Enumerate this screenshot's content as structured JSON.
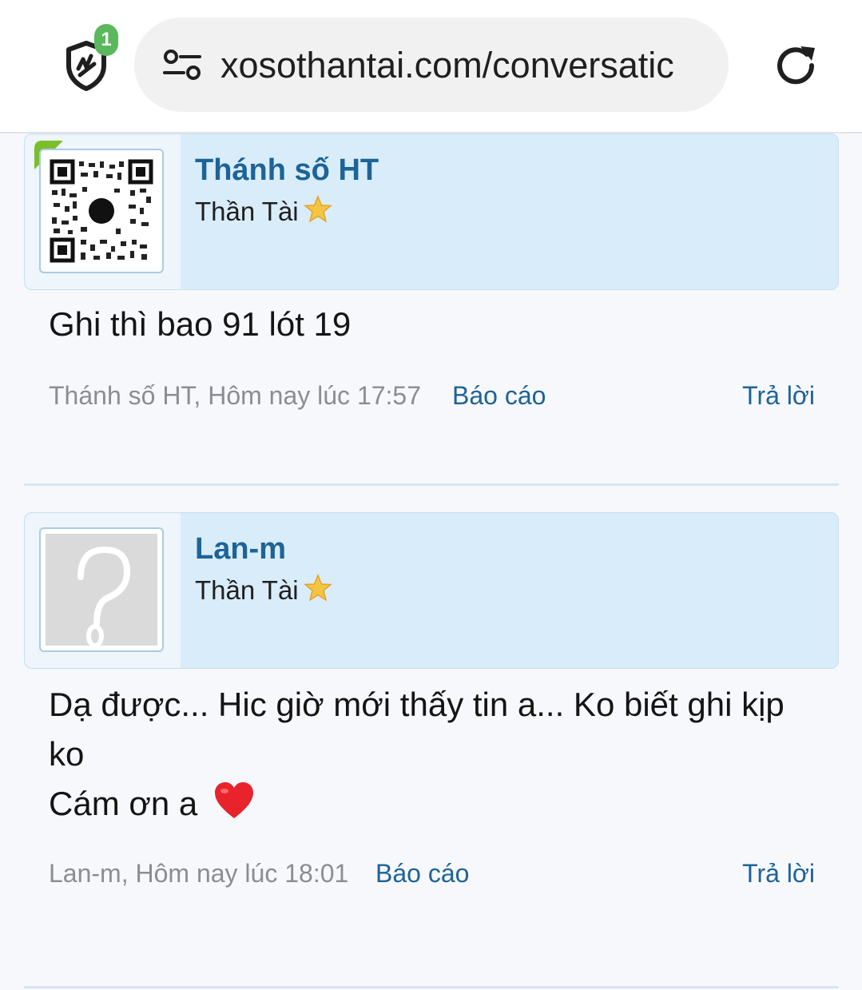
{
  "browser": {
    "notification_count": "1",
    "url": "xosothantai.com/conversatic"
  },
  "posts": [
    {
      "username": "Thánh số HT",
      "rank": "Thần Tài",
      "message_lines": [
        "Ghi thì bao 91 lót 19"
      ],
      "meta": "Thánh số HT, Hôm nay lúc 17:57",
      "report_label": "Báo cáo",
      "reply_label": "Trả lời",
      "avatar_type": "qr-code"
    },
    {
      "username": "Lan-m",
      "rank": "Thần Tài",
      "message_lines": [
        "Dạ được... Hic giờ mới thấy tin a... Ko biết ghi kịp",
        "ko",
        "Cám ơn a"
      ],
      "message_emoji": "❤️",
      "meta": "Lan-m, Hôm nay lúc 18:01",
      "report_label": "Báo cáo",
      "reply_label": "Trả lời",
      "avatar_type": "placeholder-question"
    }
  ],
  "colors": {
    "link": "#1d6397",
    "header_bg": "#d9ecfa",
    "badge": "#5bb85d"
  }
}
